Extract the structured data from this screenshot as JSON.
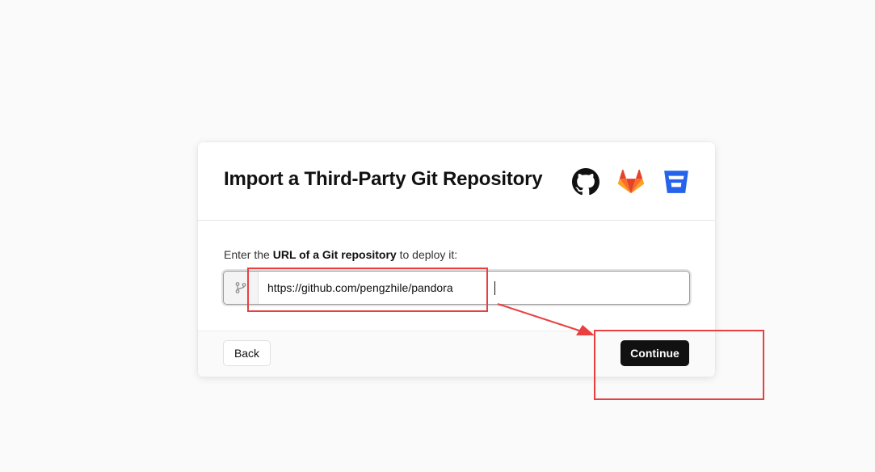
{
  "dialog": {
    "title": "Import a Third-Party Git Repository",
    "providers": [
      {
        "icon": "github-icon",
        "color": "#111111"
      },
      {
        "icon": "gitlab-icon",
        "color": "#fc6d26"
      },
      {
        "icon": "bitbucket-icon",
        "color": "#2563eb"
      }
    ],
    "prompt": {
      "before": "Enter the",
      "bold": "URL of a Git repository",
      "after": "to deploy it:"
    },
    "url_input": {
      "icon": "git-branch-icon",
      "value": "https://github.com/pengzhile/pandora"
    },
    "back_label": "Back",
    "continue_label": "Continue"
  },
  "annotations": {
    "color": "#e84040",
    "items": [
      "url-input-highlight",
      "continue-button-highlight",
      "pointer-arrow"
    ]
  }
}
